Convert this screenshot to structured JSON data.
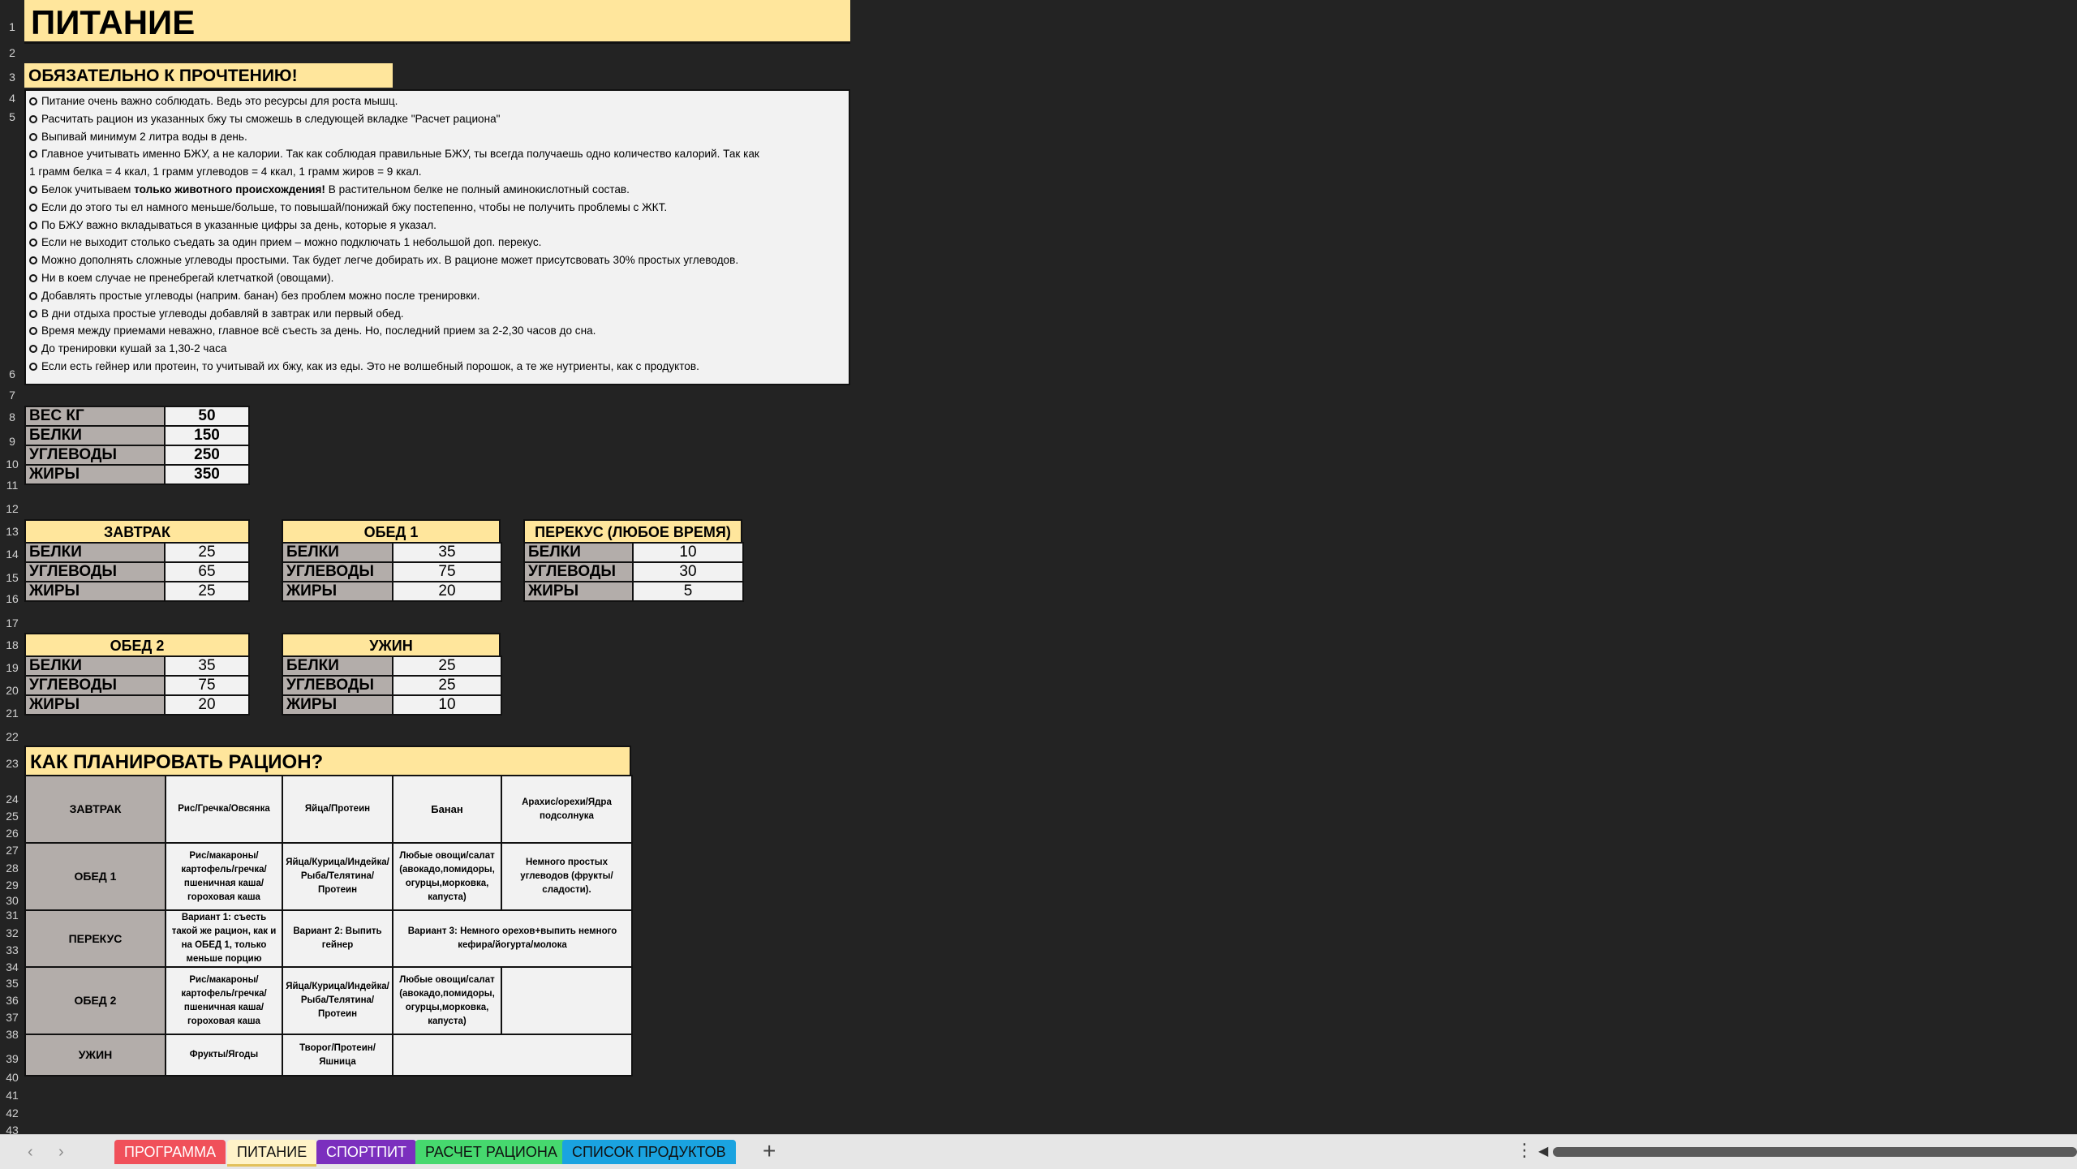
{
  "title": "ПИТАНИЕ",
  "row_numbers": [
    "1",
    "2",
    "3",
    "4",
    "5",
    "6",
    "7",
    "8",
    "9",
    "10",
    "11",
    "12",
    "13",
    "14",
    "15",
    "16",
    "17",
    "18",
    "19",
    "20",
    "21",
    "22",
    "23",
    "24",
    "25",
    "26",
    "27",
    "28",
    "29",
    "30",
    "31",
    "32",
    "33",
    "34",
    "35",
    "36",
    "37",
    "38",
    "39",
    "40",
    "41",
    "42",
    "43"
  ],
  "must_read": "ОБЯЗАТЕЛЬНО К ПРОЧТЕНИЮ!",
  "notes": [
    "Питание очень важно соблюдать. Ведь это ресурсы для роста мышц.",
    "Расчитать рацион из указанных бжу ты сможешь в следующей вкладке \"Расчет рациона\"",
    "Выпивай минимум 2 литра воды в день.",
    "Главное учитывать именно БЖУ, а не калории. Так как соблюдая правильные БЖУ, ты всегда получаешь одно количество калорий. Так как",
    "1 грамм белка = 4 ккал, 1 грамм углеводов = 4 ккал, 1 грамм жиров = 9 ккал.",
    "Белок учитываем",
    "только животного происхождения!",
    "В растительном белке не полный аминокислотный состав.",
    "Если до этого ты ел намного меньше/больше, то повышай/понижай бжу постепенно, чтобы не получить проблемы с ЖКТ.",
    "По БЖУ важно вкладываться в указанные цифры за день, которые я указал.",
    "Если не выходит столько съедать за один прием – можно подключать 1 небольшой доп. перекус.",
    "Можно дополнять сложные углеводы простыми. Так будет легче добирать их. В рационе может присутсвовать 30% простых углеводов.",
    "Ни в коем случае не пренебрегай клетчаткой (овощами).",
    "Добавлять простые углеводы (наприм. банан) без проблем можно после тренировки.",
    "В дни отдыха простые углеводы добавляй в завтрак или первый обед.",
    "Время между приемами неважно, главное всё съесть за день. Но, последний прием за 2-2,30 часов до сна.",
    "До тренировки кушай за 1,30-2 часа",
    "Если есть гейнер или протеин, то учитывай их бжу, как из еды. Это не волшебный порошок, а те же нутриенты, как с продуктов."
  ],
  "totals": [
    {
      "label": "ВЕС КГ",
      "value": "50"
    },
    {
      "label": "БЕЛКИ",
      "value": "150"
    },
    {
      "label": "УГЛЕВОДЫ",
      "value": "250"
    },
    {
      "label": "ЖИРЫ",
      "value": "350"
    }
  ],
  "meals": [
    {
      "name": "ЗАВТРАК",
      "rows": [
        {
          "label": "БЕЛКИ",
          "value": "25"
        },
        {
          "label": "УГЛЕВОДЫ",
          "value": "65"
        },
        {
          "label": "ЖИРЫ",
          "value": "25"
        }
      ]
    },
    {
      "name": "ОБЕД 1",
      "rows": [
        {
          "label": "БЕЛКИ",
          "value": "35"
        },
        {
          "label": "УГЛЕВОДЫ",
          "value": "75"
        },
        {
          "label": "ЖИРЫ",
          "value": "20"
        }
      ]
    },
    {
      "name": "ПЕРЕКУС (ЛЮБОЕ ВРЕМЯ)",
      "rows": [
        {
          "label": "БЕЛКИ",
          "value": "10"
        },
        {
          "label": "УГЛЕВОДЫ",
          "value": "30"
        },
        {
          "label": "ЖИРЫ",
          "value": "5"
        }
      ]
    },
    {
      "name": "ОБЕД 2",
      "rows": [
        {
          "label": "БЕЛКИ",
          "value": "35"
        },
        {
          "label": "УГЛЕВОДЫ",
          "value": "75"
        },
        {
          "label": "ЖИРЫ",
          "value": "20"
        }
      ]
    },
    {
      "name": "УЖИН",
      "rows": [
        {
          "label": "БЕЛКИ",
          "value": "25"
        },
        {
          "label": "УГЛЕВОДЫ",
          "value": "25"
        },
        {
          "label": "ЖИРЫ",
          "value": "10"
        }
      ]
    }
  ],
  "plan": {
    "title": "КАК ПЛАНИРОВАТЬ РАЦИОН?",
    "rows": [
      {
        "meal": "ЗАВТРАК",
        "cells": [
          "Рис/Гречка/Овсянка",
          "Яйца/Протеин",
          "Банан",
          "Арахис/орехи/Ядра подсолнука"
        ]
      },
      {
        "meal": "ОБЕД 1",
        "cells": [
          "Рис/макароны/картофель/гречка/пшеничная каша/гороховая каша",
          "Яйца/Курица/Индейка/Рыба/Телятина/Протеин",
          "Любые овощи/салат (авокадо,помидоры, огурцы,морковка, капуста)",
          "Немного простых углеводов (фрукты/сладости)."
        ]
      },
      {
        "meal": "ПЕРЕКУС",
        "cells": [
          "Вариант 1: съесть такой же рацион, как и на ОБЕД 1, только меньше порцию",
          "Вариант 2: Выпить гейнер",
          "Вариант 3: Немного орехов+выпить немного кефира/йогурта/молока"
        ]
      },
      {
        "meal": "ОБЕД 2",
        "cells": [
          "Рис/макароны/картофель/гречка/пшеничная каша/гороховая каша",
          "Яйца/Курица/Индейка/Рыба/Телятина/Протеин",
          "Любые овощи/салат (авокадо,помидоры, огурцы,морковка, капуста)",
          ""
        ]
      },
      {
        "meal": "УЖИН",
        "cells": [
          "Фрукты/Ягоды",
          "Творог/Протеин/Яшница",
          ""
        ]
      }
    ]
  },
  "tabs": [
    {
      "label": "ПРОГРАММА",
      "color": "#f0505a"
    },
    {
      "label": "ПИТАНИЕ",
      "color": "#ffe69c",
      "active": true
    },
    {
      "label": "СПОРТПИТ",
      "color": "#7b2fbe"
    },
    {
      "label": "РАСЧЕТ РАЦИОНА",
      "color": "#46d86e"
    },
    {
      "label": "СПИСОК ПРОДУКТОВ",
      "color": "#1aa3e0"
    }
  ],
  "nav": {
    "prev": "‹",
    "next": "›",
    "add": "+",
    "more": "⋮",
    "scroll_left": "◀"
  }
}
